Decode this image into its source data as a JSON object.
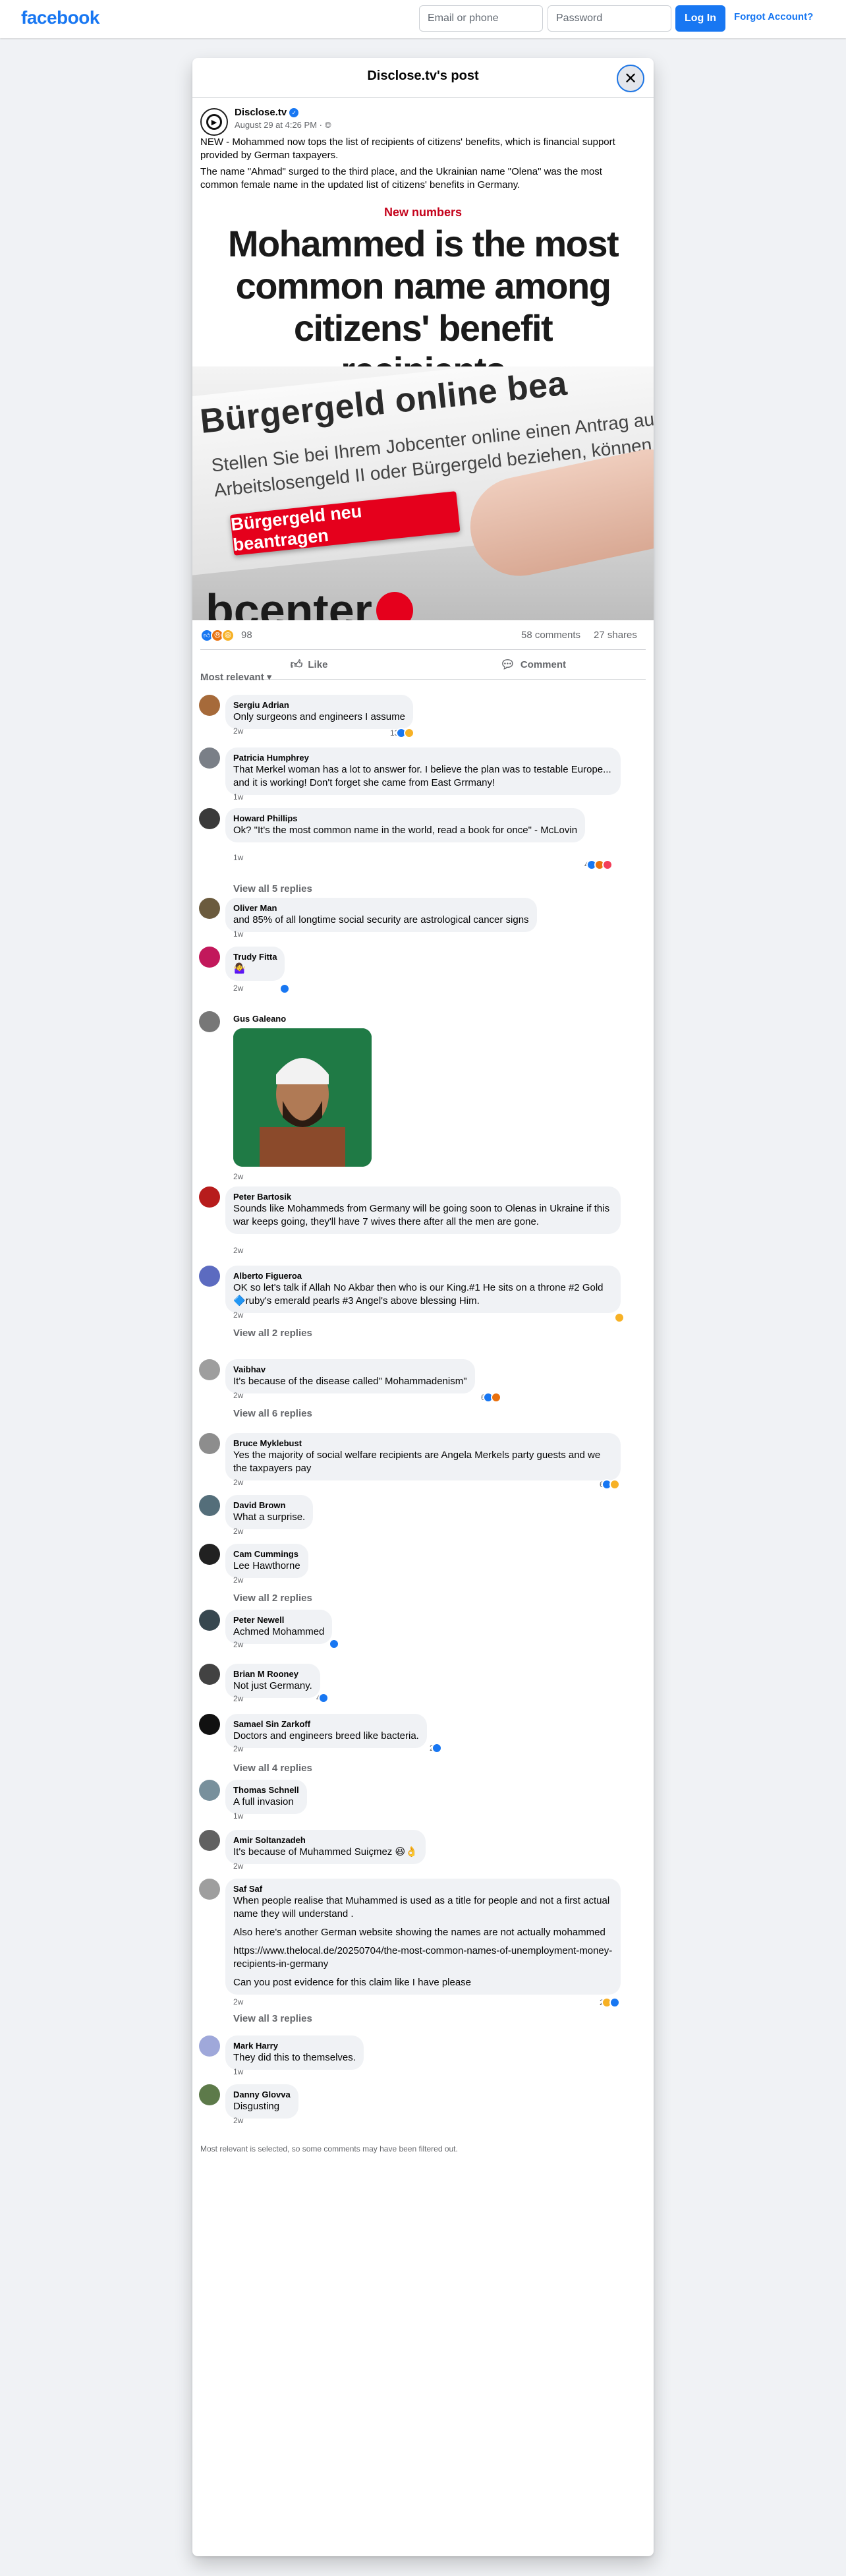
{
  "topbar": {
    "logo": "facebook",
    "email_placeholder": "Email or phone",
    "password_placeholder": "Password",
    "login_label": "Log In",
    "forgot_label": "Forgot Account?"
  },
  "modal": {
    "title": "Disclose.tv's post",
    "close_icon": "close-icon"
  },
  "post": {
    "author": "Disclose.tv",
    "date": "August 29 at 4:26 PM · ",
    "globe_icon": "globe-icon",
    "paragraph_1": "NEW - Mohammed now tops the list of recipients of citizens' benefits, which is financial support provided by German taxpayers.",
    "paragraph_2": "The name \"Ahmad\" surged to the third place, and the Ukrainian name \"Olena\" was the most common female name in the updated list of citizens' benefits in Germany.",
    "image": {
      "kicker": "New numbers",
      "headline": "Mohammed is the most common name among citizens' benefit recipients",
      "photo_big": "Bürgergeld online bea",
      "photo_line_1": "Stellen Sie bei Ihrem Jobcenter online einen Antrag auf Bürger",
      "photo_line_2": "Arbeitslosengeld II oder Bürgergeld beziehen, können Sie auch",
      "photo_button": "Bürgergeld neu beantragen",
      "photo_logo": "bcenter"
    },
    "reactions_total": "98",
    "comments_count": "58 comments",
    "shares_count": "27 shares",
    "like_label": "Like",
    "comment_label": "Comment",
    "sort_label": "Most relevant ▾"
  },
  "comments": [
    {
      "name": "Sergiu Adrian",
      "text": "Only surgeons and engineers I assume",
      "time": "2w",
      "reacts": "13"
    },
    {
      "name": "Patricia Humphrey",
      "text": "That Merkel woman has a lot to answer for. I believe the plan was to testable Europe... and it is working! Don't forget she came from East Grrmany!",
      "time": "1w"
    },
    {
      "name": "Howard Phillips",
      "text": "Ok? \"It's the most common name in the world, read a book for once\" - McLovin",
      "time": "1w",
      "reacts": "4",
      "replies": "View all 5 replies"
    },
    {
      "name": "Oliver Man",
      "text": "and 85% of all longtime social security are astrological cancer signs",
      "time": "1w"
    },
    {
      "name": "Trudy Fitta",
      "text": "🤷‍♀️",
      "time": "2w"
    },
    {
      "name": "Gus Galeano",
      "text": "",
      "time": "2w"
    },
    {
      "name": "Peter Bartosik",
      "text": "Sounds like Mohammeds from Germany will be going soon to Olenas in Ukraine if this war keeps going, they'll have 7 wives there after all the men are gone.",
      "time": "2w"
    },
    {
      "name": "Alberto Figueroa",
      "text": "OK so let's talk if Allah No Akbar then who is our King.#1 He sits on a throne #2 Gold 🔷ruby's emerald pearls #3 Angel's above blessing Him.",
      "time": "2w",
      "replies": "View all 2 replies"
    },
    {
      "name": "Vaibhav",
      "text": "It's because of the disease called\" Mohammadenism\"",
      "time": "2w",
      "reacts": "6",
      "replies": "View all 6 replies"
    },
    {
      "name": "Bruce Myklebust",
      "text": "Yes the majority of social welfare recipients are Angela Merkels party guests and we the taxpayers pay",
      "time": "2w",
      "reacts": "6"
    },
    {
      "name": "David Brown",
      "text": "What a surprise.",
      "time": "2w"
    },
    {
      "name": "Cam Cummings",
      "text": "Lee Hawthorne",
      "time": "2w",
      "replies": "View all 2 replies"
    },
    {
      "name": "Peter Newell",
      "text": "Achmed Mohammed",
      "time": "2w"
    },
    {
      "name": "Brian M Rooney",
      "text": "Not just Germany.",
      "time": "2w",
      "reacts": "4"
    },
    {
      "name": "Samael Sin Zarkoff",
      "text": "Doctors and engineers breed like bacteria.",
      "time": "2w",
      "reacts": "2",
      "replies": "View all 4 replies"
    },
    {
      "name": "Thomas Schnell",
      "text": "A full invasion",
      "time": "1w"
    },
    {
      "name": "Amir Soltanzadeh",
      "text": "It's because of Muhammed Suiçmez 😆👌",
      "time": "2w"
    },
    {
      "name": "Saf Saf",
      "text": "When people realise that Muhammed is used as a title for people and not a first actual name they will understand .",
      "text_2": "Also here's another German website showing the names are not actually mohammed",
      "text_3": "https://www.thelocal.de/20250704/the-most-common-names-of-unemployment-money-recipients-in-germany",
      "text_4": "Can you post evidence for this claim like I have please",
      "time": "2w",
      "reacts": "2",
      "replies": "View all 3 replies"
    },
    {
      "name": "Mark Harry",
      "text": "They did this to themselves.",
      "time": "1w"
    },
    {
      "name": "Danny Glovva",
      "text": "Disgusting",
      "time": "2w"
    }
  ],
  "footnote": "Most relevant is selected, so some comments may have been filtered out.",
  "colors": {
    "brand": "#1877f2",
    "headline_red": "#c4001a"
  }
}
